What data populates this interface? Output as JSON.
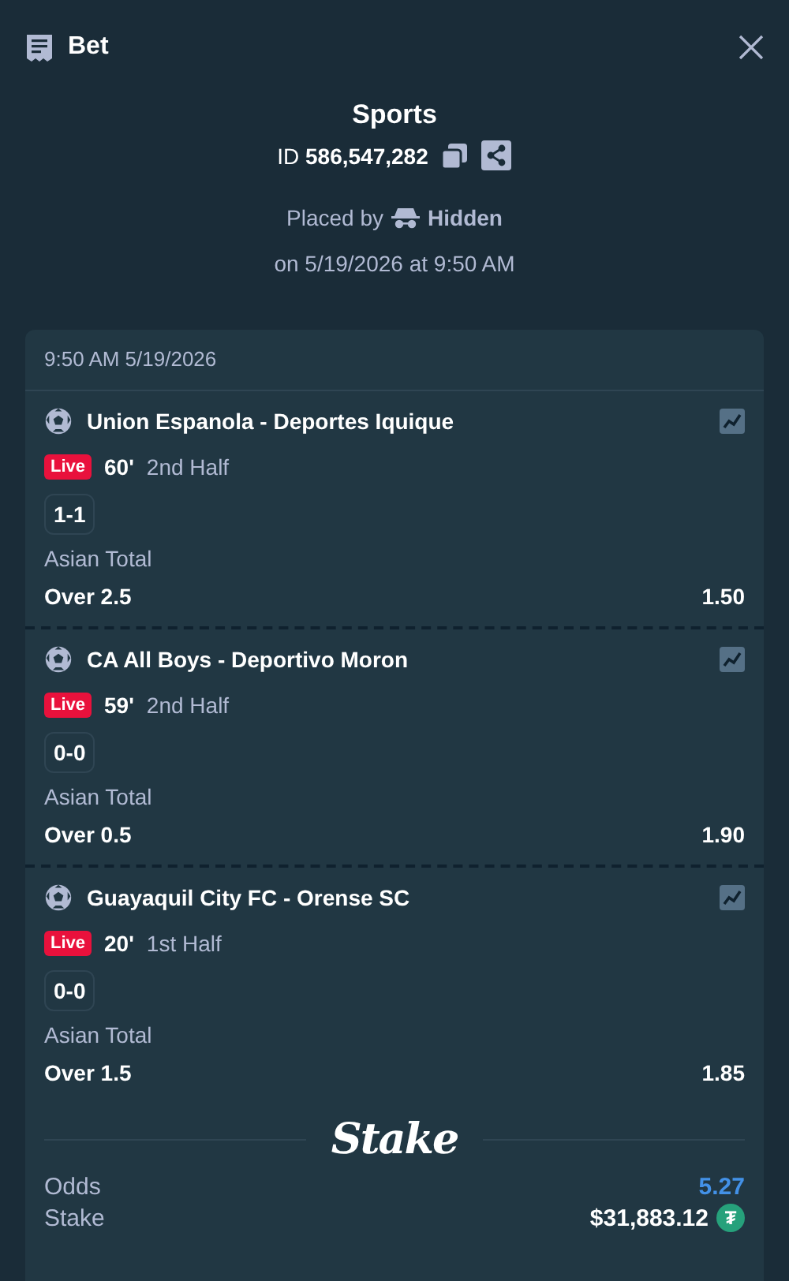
{
  "header": {
    "title": "Bet"
  },
  "summary": {
    "category": "Sports",
    "id_label": "ID",
    "id_value": "586,547,282",
    "placed_by_label": "Placed by",
    "placed_by_user": "Hidden",
    "placed_on": "on 5/19/2026 at 9:50 AM"
  },
  "card": {
    "timestamp": "9:50 AM 5/19/2026",
    "legs": [
      {
        "match": "Union Espanola - Deportes Iquique",
        "live": true,
        "live_label": "Live",
        "minute": "60'",
        "period": "2nd Half",
        "score": "1-1",
        "market": "Asian Total",
        "selection": "Over 2.5",
        "odds": "1.50"
      },
      {
        "match": "CA All Boys - Deportivo Moron",
        "live": true,
        "live_label": "Live",
        "minute": "59'",
        "period": "2nd Half",
        "score": "0-0",
        "market": "Asian Total",
        "selection": "Over 0.5",
        "odds": "1.90"
      },
      {
        "match": "Guayaquil City FC - Orense SC",
        "live": true,
        "live_label": "Live",
        "minute": "20'",
        "period": "1st Half",
        "score": "0-0",
        "market": "Asian Total",
        "selection": "Over 1.5",
        "odds": "1.85"
      }
    ],
    "brand": "Stake",
    "totals": [
      {
        "label": "Odds",
        "value": "5.27",
        "kind": "odds"
      },
      {
        "label": "Stake",
        "value": "$31,883.12",
        "kind": "currency",
        "currency_symbol": "₮"
      }
    ]
  }
}
